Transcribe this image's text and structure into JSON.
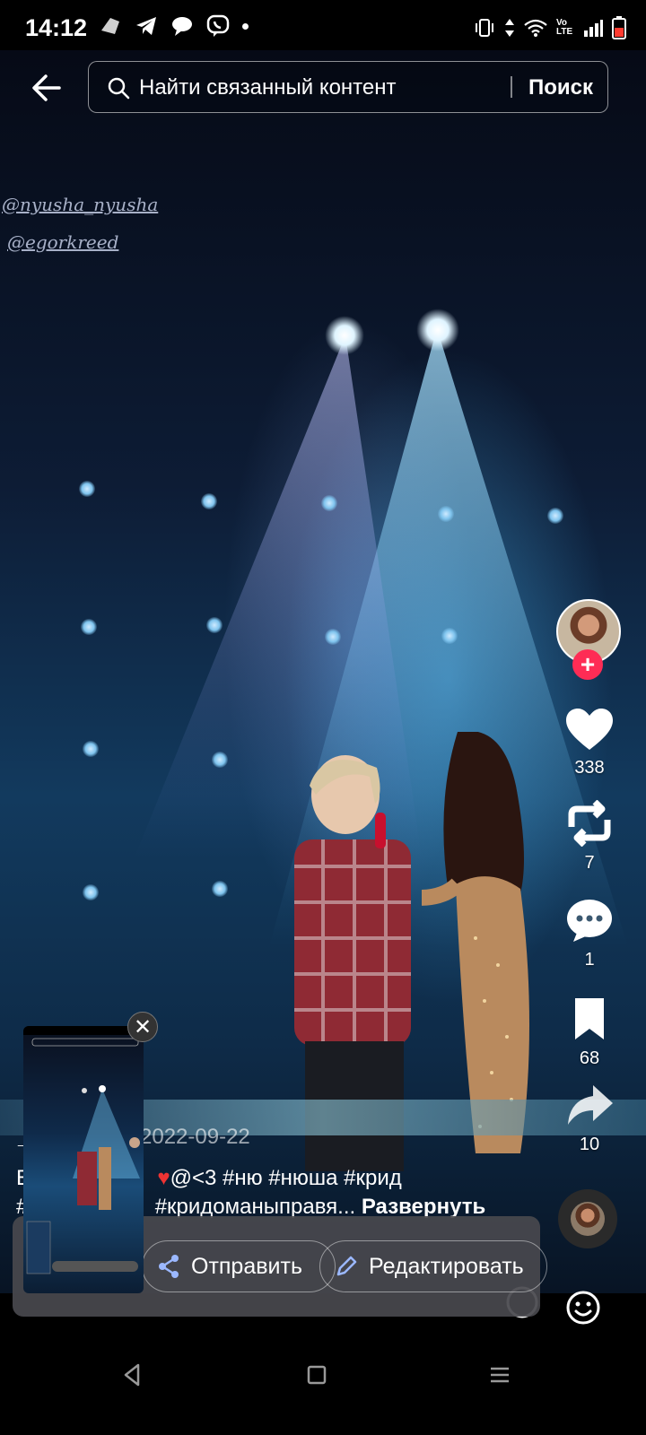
{
  "status_bar": {
    "time": "14:12",
    "left_icons": [
      "cloud-app-icon",
      "telegram-icon",
      "chat-bubble-icon",
      "viber-icon",
      "dot-icon"
    ],
    "right_icons": [
      "vibrate-icon",
      "data-arrows-icon",
      "wifi-icon",
      "volte-icon",
      "signal-icon",
      "battery-icon"
    ],
    "volte_text": "Vo LTE"
  },
  "search": {
    "query_text": "Найти связанный контент",
    "button_label": "Поиск"
  },
  "video": {
    "watermark_1": "@nyusha_nyusha",
    "watermark_2": "@egorkreed"
  },
  "right_rail": {
    "like_count": "338",
    "repost_count": "7",
    "comment_count": "1",
    "save_count": "68",
    "share_count": "10",
    "follow_symbol": "+"
  },
  "caption": {
    "author_fragment": "_",
    "date": "2022-09-22",
    "line1_start": "E",
    "line1_text": "@<3 #ню #нюша #крид",
    "line2_start": "#",
    "line2_text": "#кридоманыправя...",
    "expand_label": "Развернуть"
  },
  "share_popup": {
    "send_label": "Отправить",
    "edit_label": "Редактировать",
    "close_symbol": "✕"
  },
  "colors": {
    "follow_red": "#fe2c55",
    "panel_gray": "#48484e",
    "stage_blue": "#123a5e"
  }
}
